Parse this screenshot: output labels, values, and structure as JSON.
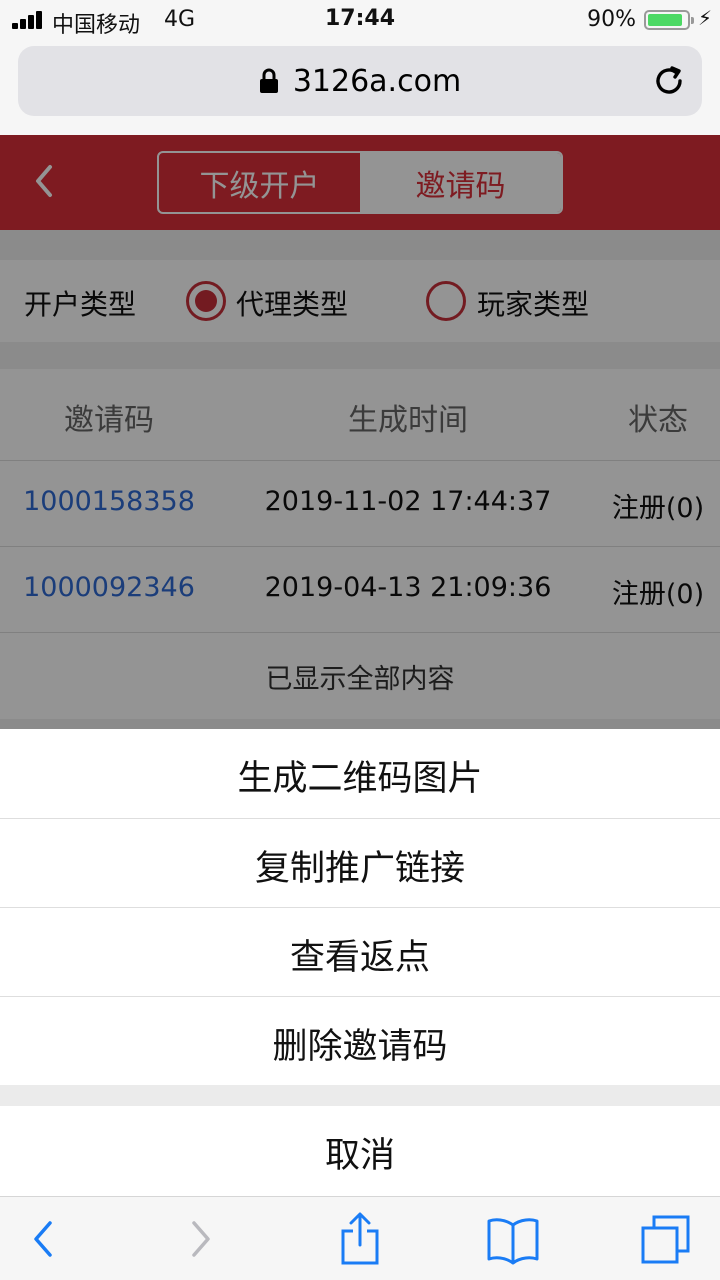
{
  "status_bar": {
    "carrier": "中国移动",
    "network": "4G",
    "time": "17:44",
    "battery_percent": "90%",
    "battery_level": 0.9
  },
  "browser": {
    "url": "3126a.com"
  },
  "header": {
    "tabs": [
      {
        "label": "下级开户",
        "active": false
      },
      {
        "label": "邀请码",
        "active": true
      }
    ]
  },
  "account_type": {
    "label": "开户类型",
    "options": [
      {
        "label": "代理类型",
        "selected": true
      },
      {
        "label": "玩家类型",
        "selected": false
      }
    ]
  },
  "table": {
    "columns": [
      "邀请码",
      "生成时间",
      "状态"
    ],
    "rows": [
      {
        "code": "1000158358",
        "time": "2019-11-02 17:44:37",
        "status": "注册(0)"
      },
      {
        "code": "1000092346",
        "time": "2019-04-13 21:09:36",
        "status": "注册(0)"
      }
    ],
    "footer": "已显示全部内容"
  },
  "action_sheet": {
    "items": [
      "生成二维码图片",
      "复制推广链接",
      "查看返点",
      "删除邀请码"
    ],
    "cancel": "取消"
  },
  "colors": {
    "brand_red": "#d9303a",
    "link_blue": "#2f6ad3",
    "ios_blue": "#1a7cf5",
    "battery_green": "#4cd964"
  }
}
